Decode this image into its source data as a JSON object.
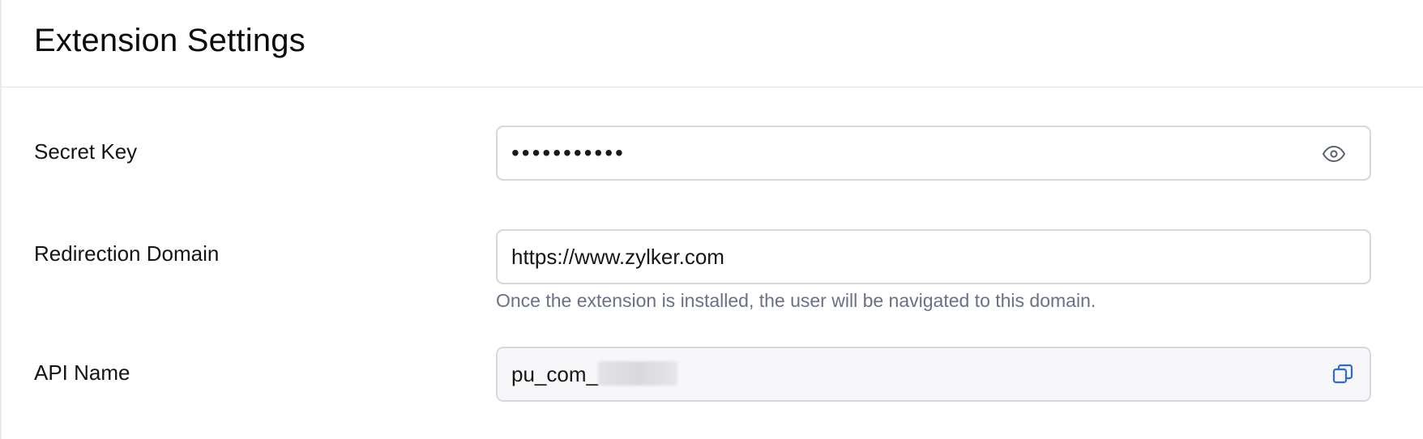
{
  "header": {
    "title": "Extension Settings"
  },
  "fields": {
    "secret_key": {
      "label": "Secret Key",
      "value": "•••••••••••",
      "icon": "eye-icon"
    },
    "redirection_domain": {
      "label": "Redirection Domain",
      "value": "https://www.zylker.com",
      "helper": "Once the extension is installed, the user will be navigated to this domain."
    },
    "api_name": {
      "label": "API Name",
      "value_visible": "pu_com_",
      "icon": "copy-icon"
    }
  },
  "colors": {
    "border": "#d6d8e0",
    "helper_text": "#6a7088",
    "accent_icon": "#2d6bd8",
    "readonly_bg": "#f7f7fa"
  }
}
